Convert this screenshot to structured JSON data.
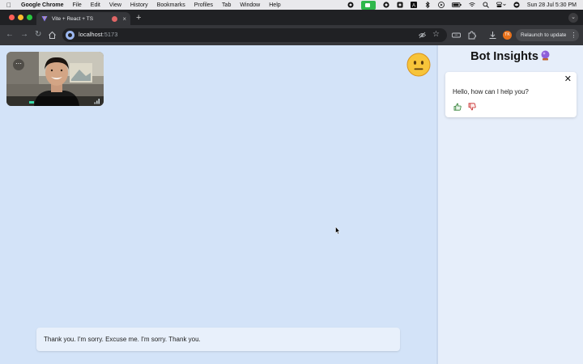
{
  "menubar": {
    "app_name": "Google Chrome",
    "items": [
      "File",
      "Edit",
      "View",
      "History",
      "Bookmarks",
      "Profiles",
      "Tab",
      "Window",
      "Help"
    ],
    "datetime": "Sun 28 Jul  5:30 PM"
  },
  "tab": {
    "title": "Vite + React + TS"
  },
  "toolbar": {
    "url_host": "localhost",
    "url_port": ":5173",
    "profile_initials": "TK",
    "relaunch_label": "Relaunch to update"
  },
  "transcript": {
    "text": "Thank you. I'm sorry. Excuse me. I'm sorry. Thank you."
  },
  "sidebar": {
    "title": "Bot Insights",
    "card_message": "Hello, how can I help you?"
  },
  "icons": {
    "emoji": "neutral-face-icon",
    "title_icon": "crystal-ball-icon",
    "close": "close-icon",
    "feedback_up": "thumbs-up-icon",
    "feedback_down": "thumbs-down-icon"
  },
  "colors": {
    "content_bg": "#d3e3f8",
    "sidebar_bg": "#e6eefa",
    "facetime_green": "#2fb84b",
    "thumbs_up": "#2e7d32",
    "thumbs_down": "#c62828"
  }
}
